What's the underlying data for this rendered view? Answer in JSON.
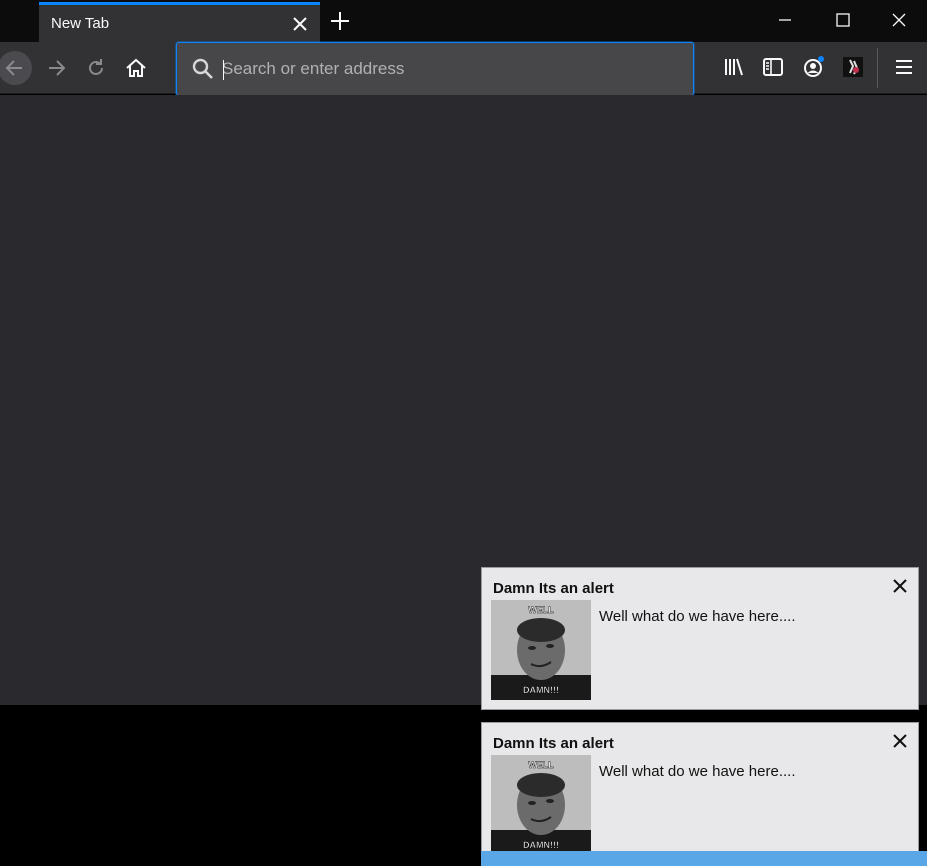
{
  "browser": {
    "tab": {
      "title": "New Tab"
    },
    "urlbar": {
      "placeholder": "Search or enter address"
    }
  },
  "notifications": [
    {
      "title": "Damn Its an alert",
      "body": "Well what do we have here....",
      "image_top_text": "WELL",
      "image_bottom_text": "DAMN!!!"
    },
    {
      "title": "Damn Its an alert",
      "body": "Well what do we have here....",
      "image_top_text": "WELL",
      "image_bottom_text": "DAMN!!!"
    }
  ],
  "colors": {
    "accent": "#0a84ff",
    "toolbar": "#323234",
    "content_bg": "#2a2a2e",
    "notification_bg": "#e8e8ea"
  },
  "icons": [
    "close-icon",
    "plus-icon",
    "minimize-icon",
    "maximize-icon",
    "back-arrow-icon",
    "forward-arrow-icon",
    "reload-icon",
    "home-icon",
    "search-icon",
    "library-icon",
    "sidebar-icon",
    "account-icon",
    "extension-icon",
    "menu-icon"
  ]
}
